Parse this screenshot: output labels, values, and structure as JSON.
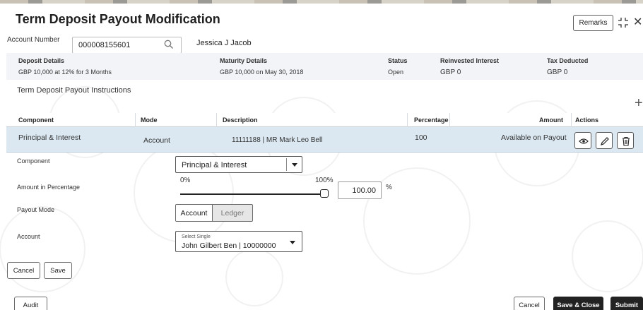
{
  "header": {
    "title": "Term Deposit Payout Modification",
    "remarks_label": "Remarks",
    "close_glyph": "✕",
    "icons": {
      "expand": "expand-icon",
      "close": "close-icon"
    }
  },
  "account": {
    "label": "Account Number",
    "value": "000008155601",
    "customer_name": "Jessica J Jacob",
    "icons": {
      "search": "search-icon"
    }
  },
  "deposit_summary": {
    "deposit_details_label": "Deposit Details",
    "deposit_details_value": "GBP 10,000 at 12% for 3 Months",
    "maturity_details_label": "Maturity Details",
    "maturity_details_value": "GBP 10,000 on May 30, 2018",
    "status_label": "Status",
    "status_value": "Open",
    "reinvested_interest_label": "Reinvested Interest",
    "reinvested_interest_value": "GBP 0",
    "tax_deducted_label": "Tax Deducted",
    "tax_deducted_value": "GBP 0"
  },
  "instructions": {
    "section_label": "Term Deposit Payout Instructions",
    "add_glyph": "+",
    "columns": [
      "Component",
      "Mode",
      "Description",
      "Percentage",
      "Amount",
      "Actions"
    ],
    "rows": [
      {
        "component": "Principal & Interest",
        "mode": "Account",
        "description": "11111188 | MR Mark Leo Bell",
        "percentage": "100",
        "amount": "Available on Payout"
      }
    ],
    "action_icons": [
      "view-icon",
      "edit-icon",
      "delete-icon"
    ]
  },
  "form": {
    "component_label": "Component",
    "component_value": "Principal & Interest",
    "amount_pct_label": "Amount in Percentage",
    "slider_min_label": "0%",
    "slider_max_label": "100%",
    "slider_value": 1.0,
    "percentage_value": "100.00",
    "percent_sign": "%",
    "payout_mode_label": "Payout Mode",
    "payout_mode_options": [
      "Account",
      "Ledger"
    ],
    "payout_mode_selected": "Account",
    "account_label": "Account",
    "account_select_hint": "Select Single",
    "account_value": "John Gilbert Ben | 10000000"
  },
  "form_actions": {
    "cancel_label": "Cancel",
    "save_label": "Save"
  },
  "footer": {
    "audit_label": "Audit",
    "cancel_label": "Cancel",
    "save_close_label": "Save & Close",
    "submit_label": "Submit"
  },
  "colors": {
    "row_highlight": "#dbe8f1",
    "summary_bg": "#f2f4f7",
    "primary_dark": "#222222"
  }
}
